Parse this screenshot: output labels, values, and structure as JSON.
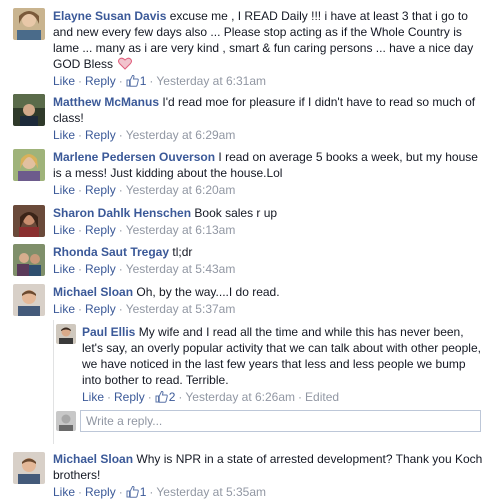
{
  "comments": [
    {
      "name": "Elayne Susan Davis",
      "text": "excuse me , I READ Daily !!! i have at least 3 that i go to and new every few days also ... Please stop acting as if the Whole Country is lame ... many as i are very kind , smart & fun caring persons ... have a nice day GOD Bless",
      "like": "Like",
      "reply": "Reply",
      "likes": "1",
      "time": "Yesterday at 6:31am"
    },
    {
      "name": "Matthew McManus",
      "text": "I'd read moe for pleasure if I didn't have to read so much of class!",
      "like": "Like",
      "reply": "Reply",
      "time": "Yesterday at 6:29am"
    },
    {
      "name": "Marlene Pedersen Ouverson",
      "text": "I read on average 5 books a week, but my house is a mess! Just kidding about the house.Lol",
      "like": "Like",
      "reply": "Reply",
      "time": "Yesterday at 6:20am"
    },
    {
      "name": "Sharon Dahlk Henschen",
      "text": "Book sales r up",
      "like": "Like",
      "reply": "Reply",
      "time": "Yesterday at 6:13am"
    },
    {
      "name": "Rhonda Saut Tregay",
      "text": "tl;dr",
      "like": "Like",
      "reply": "Reply",
      "time": "Yesterday at 5:43am"
    },
    {
      "name": "Michael Sloan",
      "text": "Oh, by the way....I do read.",
      "like": "Like",
      "reply": "Reply",
      "time": "Yesterday at 5:37am"
    }
  ],
  "reply": {
    "name": "Paul Ellis",
    "text": "My wife and I read all the time and while this has never been, let's say, an overly popular activity that we can talk about with other people, we have noticed in the last few years that less and less people we bump into bother to read. Terrible.",
    "like": "Like",
    "reply": "Reply",
    "likes": "2",
    "time": "Yesterday at 6:26am",
    "edited": "Edited"
  },
  "reply_input": {
    "placeholder": "Write a reply..."
  },
  "last_comment": {
    "name": "Michael Sloan",
    "text": "Why is NPR in a state of arrested development? Thank you Koch brothers!",
    "like": "Like",
    "reply": "Reply",
    "likes": "1",
    "time": "Yesterday at 5:35am"
  },
  "colors": {
    "link": "#3b5998",
    "meta": "#9197a3",
    "text": "#141823"
  }
}
